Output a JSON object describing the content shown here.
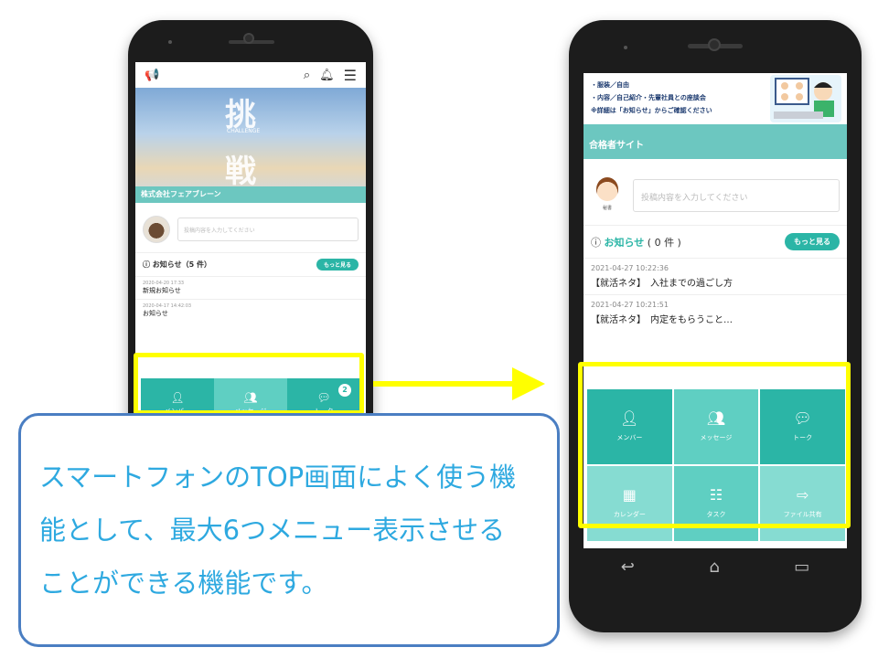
{
  "left_phone": {
    "hero_kanji_1": "挑",
    "hero_kanji_2": "戦",
    "hero_subtext": "CHALLENGE",
    "company": "株式会社フェアブレーン",
    "post_placeholder": "投稿内容を入力してください",
    "news_title": "お知らせ（5 件）",
    "more_button": "もっと見る",
    "news_items": [
      {
        "date": "2020-04-20 17:33",
        "text": "新規お知らせ"
      },
      {
        "date": "2020-04-17 14:42:03",
        "text": "お知らせ"
      }
    ],
    "menu": [
      {
        "label": "メンバー",
        "icon": "person-icon"
      },
      {
        "label": "メッセージ",
        "icon": "group-message-icon"
      },
      {
        "label": "トーク",
        "icon": "talk-icon",
        "badge": "2"
      }
    ],
    "bottom_nav_icons": [
      "home-icon",
      "document-icon",
      "account-icon",
      "help-icon"
    ]
  },
  "right_phone": {
    "banner_lines": [
      "・服装／自由",
      "・内容／自己紹介・先輩社員との座談会",
      "※詳細は「お知らせ」からご確認ください"
    ],
    "site_title": "合格者サイト",
    "avatar_label": "秘書",
    "post_placeholder": "投稿内容を入力してください",
    "news_title": "お知らせ",
    "news_count": "( 0 件 )",
    "more_button": "もっと見る",
    "news_items": [
      {
        "date": "2021-04-27 10:22:36",
        "text": "【就活ネタ】　入社までの過ごし方"
      },
      {
        "date": "2021-04-27 10:21:51",
        "text": "【就活ネタ】　内定をもらうこと…"
      }
    ],
    "menu": [
      {
        "label": "メンバー",
        "icon": "person-icon"
      },
      {
        "label": "メッセージ",
        "icon": "group-message-icon"
      },
      {
        "label": "トーク",
        "icon": "talk-icon"
      },
      {
        "label": "カレンダー",
        "icon": "calendar-icon"
      },
      {
        "label": "タスク",
        "icon": "task-list-icon"
      },
      {
        "label": "ファイル共有",
        "icon": "folder-share-icon"
      }
    ]
  },
  "callout": {
    "line1": "スマートフォンのTOP画面によく使う機",
    "line2": "能として、最大6つメニュー表示させる",
    "line3": "ことができる機能です。"
  },
  "colors": {
    "teal": "#2bb5a6",
    "highlight": "#ffff00",
    "callout_border": "#4a7ec2",
    "callout_text": "#2ea9e0"
  }
}
